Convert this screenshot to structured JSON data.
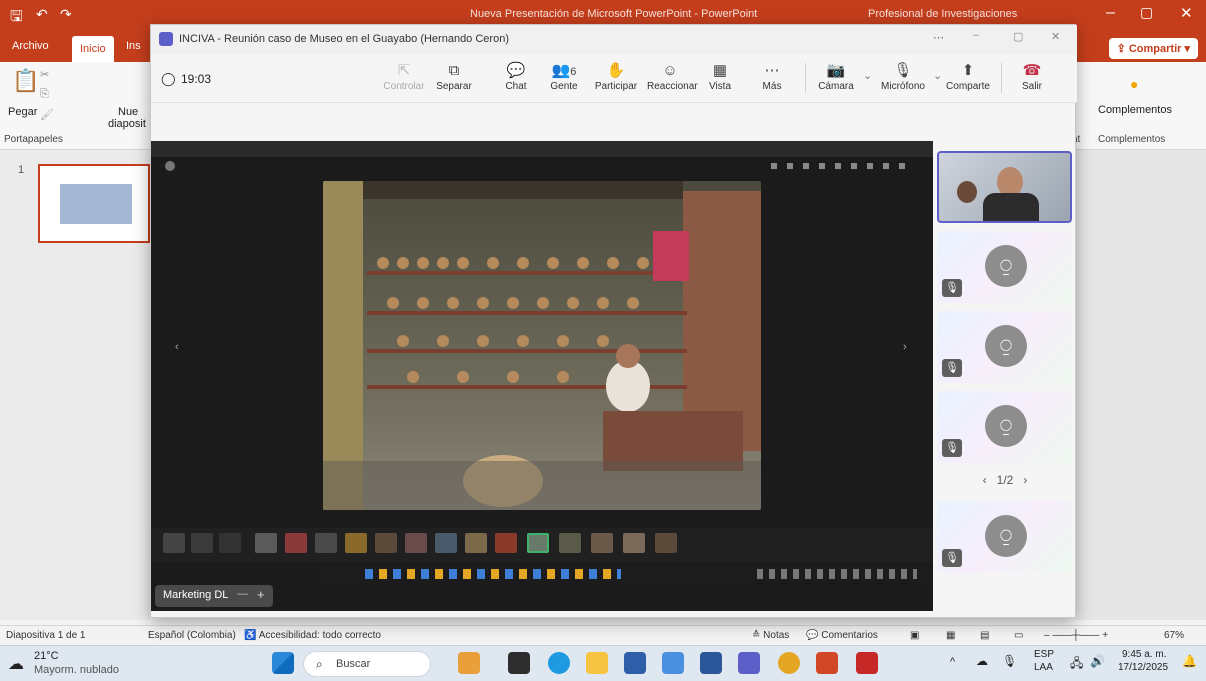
{
  "ppt": {
    "title": "Nueva Presentación de Microsoft PowerPoint - PowerPoint",
    "account": "Profesional de Investigaciones",
    "tabs": [
      "Archivo",
      "Inicio",
      "Ins"
    ],
    "share": "Compartir",
    "ribbon": {
      "pegar": "Pegar",
      "nueva_diapo": "Nue",
      "diapo2": "diaposit",
      "portapapeles": "Portapapeles",
      "complementos_btn": "Complementos",
      "complementos_grp": "Complementos",
      "at": "at"
    },
    "slide_number": "1",
    "status": {
      "slide": "Diapositiva 1 de 1",
      "language": "Español (Colombia)",
      "accessibility": "Accesibilidad: todo correcto",
      "notes": "Notas",
      "comments": "Comentarios",
      "zoom": "67%"
    }
  },
  "teams": {
    "window_title": "INCIVA - Reunión caso de Museo en el Guayabo (Hernando Ceron)",
    "timer": "19:03",
    "tools": [
      {
        "label": "Controlar",
        "icon": "⇱"
      },
      {
        "label": "Separar",
        "icon": "⧉"
      },
      {
        "label": "Chat",
        "icon": "💬"
      },
      {
        "label": "Gente",
        "icon": "👥"
      },
      {
        "label": "Participar",
        "icon": "✋"
      },
      {
        "label": "Reaccionar",
        "icon": "☺"
      },
      {
        "label": "Vista",
        "icon": "▦"
      },
      {
        "label": "Más",
        "icon": "⋯"
      },
      {
        "label": "Cámara",
        "icon": "📷"
      },
      {
        "label": "Micrófono",
        "icon": "🎙"
      },
      {
        "label": "Comparte",
        "icon": "⬆"
      },
      {
        "label": "Salir",
        "icon": "☎"
      }
    ],
    "people_count": "6",
    "stage_tab": "Marketing DL",
    "pager": "1/2"
  },
  "taskbar": {
    "weather_temp": "21°C",
    "weather_desc": "Mayorm. nublado",
    "search": "Buscar",
    "lang1": "ESP",
    "lang2": "LAA",
    "time": "9:45 a. m.",
    "date": "17/12/2025"
  }
}
